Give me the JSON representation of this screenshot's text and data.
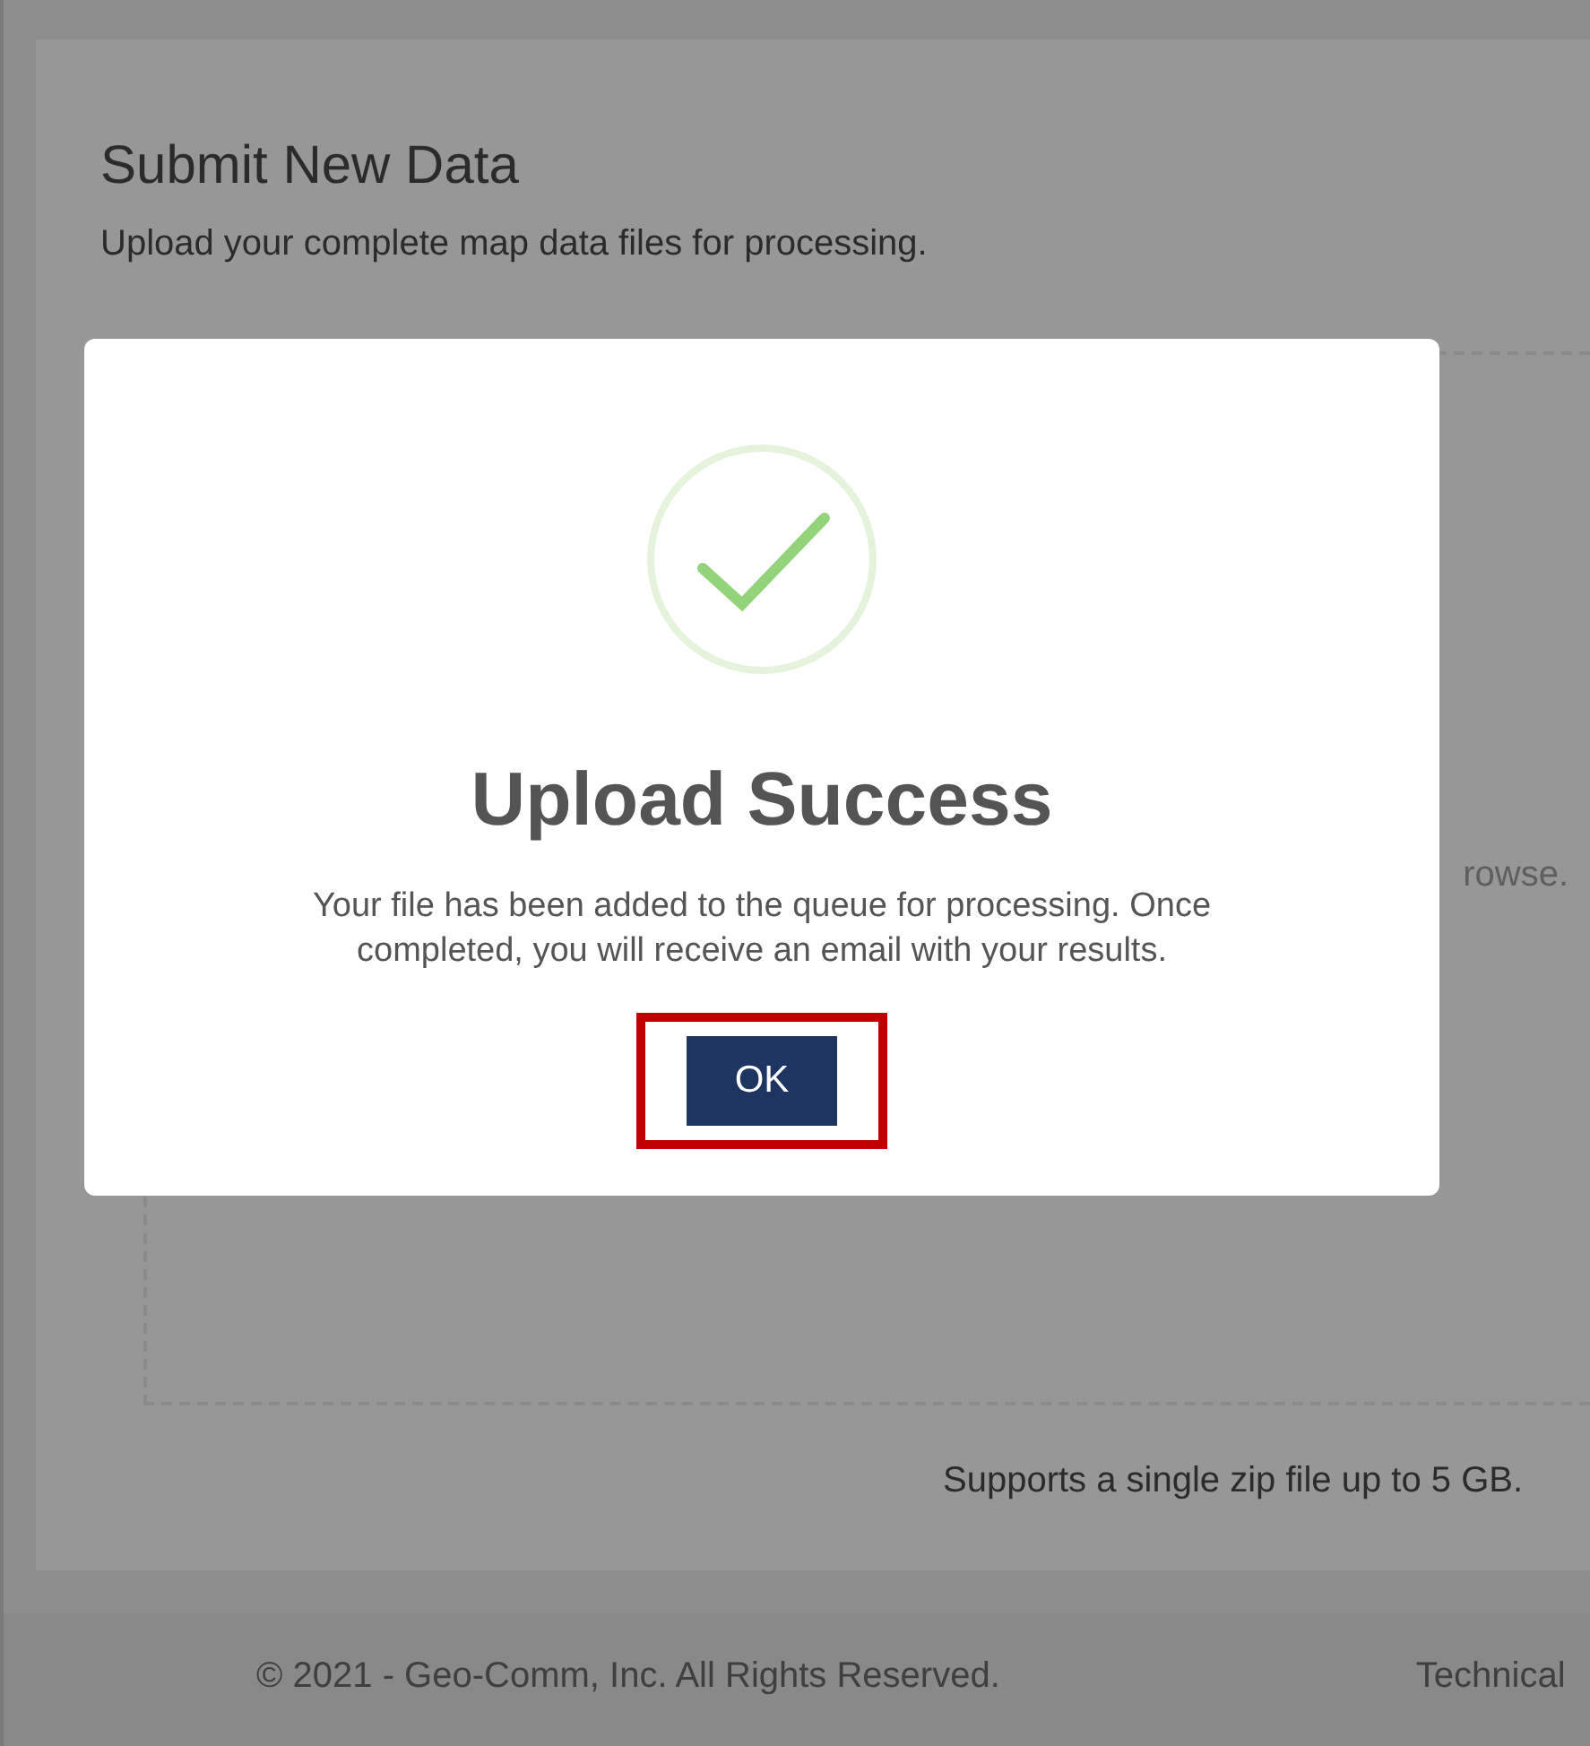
{
  "page": {
    "title": "Submit New Data",
    "subtitle": "Upload your complete map data files for processing.",
    "dropzone_text": "rowse.",
    "note": "Supports a single zip file up to 5 GB."
  },
  "footer": {
    "copyright": "© 2021 - Geo-Comm, Inc. All Rights Reserved.",
    "link": "Technical"
  },
  "dialog": {
    "title": "Upload Success",
    "message": "Your file has been added to the queue for processing. Once completed, you will receive an email with your results.",
    "button": "OK",
    "button_highlighted": true
  }
}
